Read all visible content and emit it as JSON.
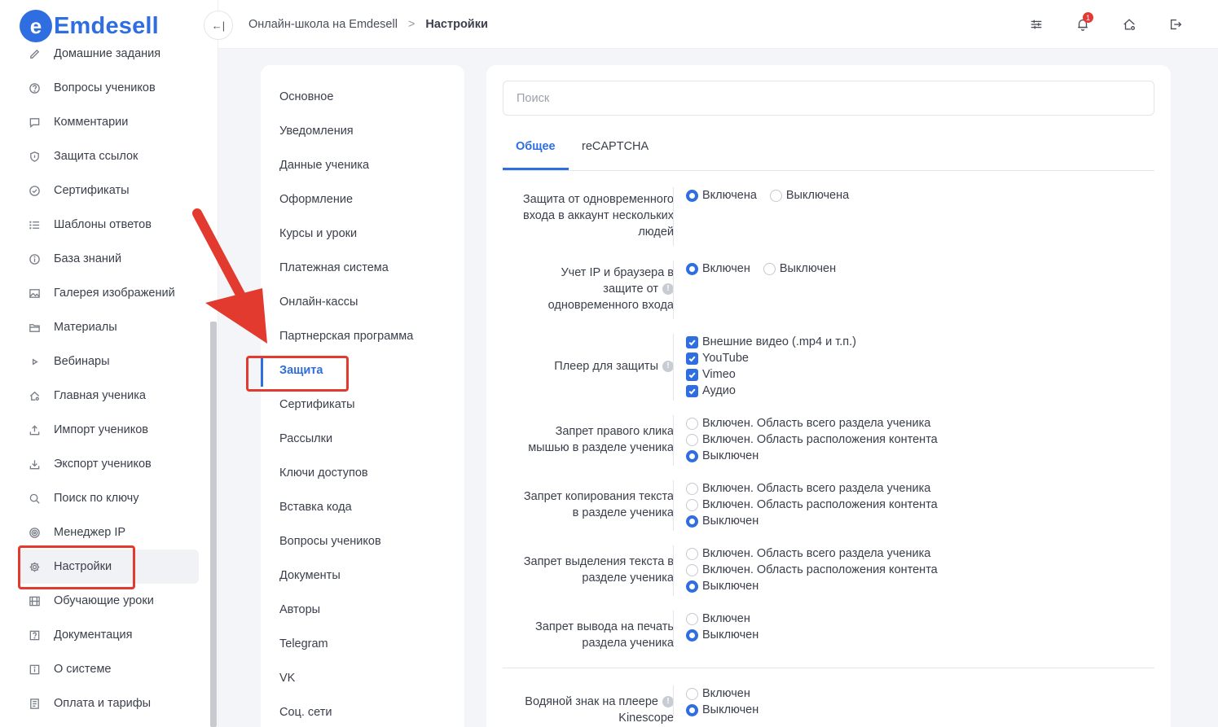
{
  "logo": {
    "badge": "e",
    "text": "Emdesell"
  },
  "sidebar": {
    "items": [
      {
        "label": "Домашние задания",
        "icon": "pencil-icon"
      },
      {
        "label": "Вопросы учеников",
        "icon": "question-circle-icon"
      },
      {
        "label": "Комментарии",
        "icon": "comment-icon"
      },
      {
        "label": "Защита ссылок",
        "icon": "shield-icon"
      },
      {
        "label": "Сертификаты",
        "icon": "check-circle-icon"
      },
      {
        "label": "Шаблоны ответов",
        "icon": "list-icon"
      },
      {
        "label": "База знаний",
        "icon": "info-circle-icon"
      },
      {
        "label": "Галерея изображений",
        "icon": "image-icon"
      },
      {
        "label": "Материалы",
        "icon": "folder-icon"
      },
      {
        "label": "Вебинары",
        "icon": "play-icon"
      },
      {
        "label": "Главная ученика",
        "icon": "home-icon"
      },
      {
        "label": "Импорт учеников",
        "icon": "upload-icon"
      },
      {
        "label": "Экспорт учеников",
        "icon": "download-icon"
      },
      {
        "label": "Поиск по ключу",
        "icon": "search-icon"
      },
      {
        "label": "Менеджер IP",
        "icon": "target-icon"
      },
      {
        "label": "Настройки",
        "icon": "gear-icon",
        "active": true
      },
      {
        "label": "Обучающие уроки",
        "icon": "film-icon"
      },
      {
        "label": "Документация",
        "icon": "help-square-icon"
      },
      {
        "label": "О системе",
        "icon": "info-square-icon"
      },
      {
        "label": "Оплата и тарифы",
        "icon": "receipt-icon"
      }
    ]
  },
  "header": {
    "collapse_label": "←|",
    "breadcrumb": {
      "root": "Онлайн-школа на Emdesell",
      "sep": ">",
      "current": "Настройки"
    },
    "notifications_count": "1"
  },
  "settings_menu": {
    "items": [
      "Основное",
      "Уведомления",
      "Данные ученика",
      "Оформление",
      "Курсы и уроки",
      "Платежная система",
      "Онлайн-кассы",
      "Партнерская программа",
      "Защита",
      "Сертификаты",
      "Рассылки",
      "Ключи доступов",
      "Вставка кода",
      "Вопросы учеников",
      "Документы",
      "Авторы",
      "Telegram",
      "VK",
      "Соц. сети"
    ],
    "active": "Защита"
  },
  "main": {
    "search_placeholder": "Поиск",
    "tabs": [
      {
        "label": "Общее",
        "active": true
      },
      {
        "label": "reCAPTCHA"
      }
    ],
    "rows": [
      {
        "label_lines": [
          "Защита от одновременного",
          "входа в аккаунт нескольких",
          "людей"
        ],
        "inline": true,
        "options": [
          {
            "type": "radio",
            "label": "Включена",
            "on": true
          },
          {
            "type": "radio",
            "label": "Выключена",
            "on": false
          }
        ]
      },
      {
        "label_lines": [
          "Учет IP и браузера в",
          "защите от",
          "одновременного входа"
        ],
        "info_line": 1,
        "inline": true,
        "options": [
          {
            "type": "radio",
            "label": "Включен",
            "on": true
          },
          {
            "type": "radio",
            "label": "Выключен",
            "on": false
          }
        ]
      },
      {
        "label_lines": [
          "Плеер для защиты"
        ],
        "info_line": 0,
        "options": [
          {
            "type": "check",
            "label": "Внешние видео (.mp4 и т.п.)"
          },
          {
            "type": "check",
            "label": "YouTube"
          },
          {
            "type": "check",
            "label": "Vimeo"
          },
          {
            "type": "check",
            "label": "Аудио"
          }
        ]
      },
      {
        "label_lines": [
          "Запрет правого клика",
          "мышью в разделе ученика"
        ],
        "options": [
          {
            "type": "radio",
            "label": "Включен. Область всего раздела ученика",
            "on": false
          },
          {
            "type": "radio",
            "label": "Включен. Область расположения контента",
            "on": false
          },
          {
            "type": "radio",
            "label": "Выключен",
            "on": true
          }
        ]
      },
      {
        "label_lines": [
          "Запрет копирования текста",
          "в разделе ученика"
        ],
        "options": [
          {
            "type": "radio",
            "label": "Включен. Область всего раздела ученика",
            "on": false
          },
          {
            "type": "radio",
            "label": "Включен. Область расположения контента",
            "on": false
          },
          {
            "type": "radio",
            "label": "Выключен",
            "on": true
          }
        ]
      },
      {
        "label_lines": [
          "Запрет выделения текста в",
          "разделе ученика"
        ],
        "options": [
          {
            "type": "radio",
            "label": "Включен. Область всего раздела ученика",
            "on": false
          },
          {
            "type": "radio",
            "label": "Включен. Область расположения контента",
            "on": false
          },
          {
            "type": "radio",
            "label": "Выключен",
            "on": true
          }
        ]
      },
      {
        "label_lines": [
          "Запрет вывода на печать",
          "раздела ученика"
        ],
        "options": [
          {
            "type": "radio",
            "label": "Включен",
            "on": false
          },
          {
            "type": "radio",
            "label": "Выключен",
            "on": true
          }
        ]
      },
      {
        "label_lines": [
          "Водяной знак на плеере",
          "Kinescope"
        ],
        "info_line": 0,
        "options": [
          {
            "type": "radio",
            "label": "Включен",
            "on": false
          },
          {
            "type": "radio",
            "label": "Выключен",
            "on": true
          }
        ]
      }
    ]
  },
  "colors": {
    "accent": "#2f6ee0",
    "annotation": "#e23a2e",
    "background": "#f4f5f8"
  }
}
